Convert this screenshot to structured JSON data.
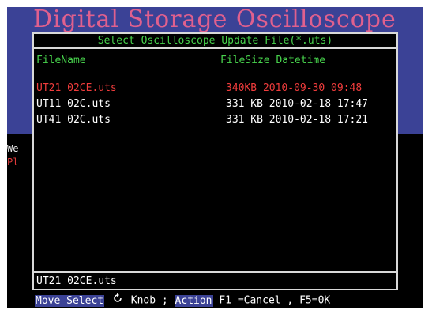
{
  "banner": {
    "title": "Digital Storage Oscilloscope"
  },
  "background": {
    "line1": "We",
    "line2": "Pl"
  },
  "dialog": {
    "title": "Select Oscilloscope Update File(*.uts)",
    "header": {
      "filename": "FileName",
      "filesize_datetime": "FileSize Datetime"
    },
    "files": [
      {
        "name": "UT21 02CE.uts",
        "meta": " 340KB 2010-09-30 09:48",
        "selected": true
      },
      {
        "name": "UT11 02C.uts",
        "meta": " 331 KB 2010-02-18 17:47",
        "selected": false
      },
      {
        "name": "UT41 02C.uts",
        "meta": " 331 KB 2010-02-18 17:21",
        "selected": false
      }
    ],
    "current_file": "UT21 02CE.uts"
  },
  "help": {
    "move_select": "Move Select",
    "knob": "Knob ;",
    "action": "Action",
    "keys": "F1 =Cancel , F5=0K"
  },
  "colors": {
    "accent_green": "#47d24c",
    "selected_red": "#f03c3c",
    "banner_blue": "#3b4296"
  },
  "icons": {
    "knob": "rotate-knob-icon"
  }
}
